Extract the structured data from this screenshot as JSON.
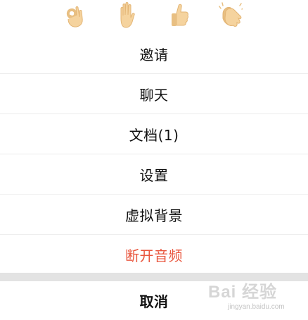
{
  "reactions": [
    {
      "name": "ok-hand-emoji"
    },
    {
      "name": "raised-hand-emoji"
    },
    {
      "name": "thumbs-up-emoji"
    },
    {
      "name": "clapping-hands-emoji"
    }
  ],
  "menu": {
    "items": [
      {
        "label": "邀请"
      },
      {
        "label": "聊天"
      },
      {
        "label": "文档(1)"
      },
      {
        "label": "设置"
      },
      {
        "label": "虚拟背景"
      },
      {
        "label": "断开音频",
        "color": "#e9573f"
      }
    ],
    "cancel_label": "取消"
  },
  "colors": {
    "danger": "#e9573f",
    "skin": "#f5d39e",
    "divider_band": "#e3e3e3"
  },
  "watermark": {
    "logo": "Bai 经验",
    "url": "jingyan.baidu.com"
  }
}
